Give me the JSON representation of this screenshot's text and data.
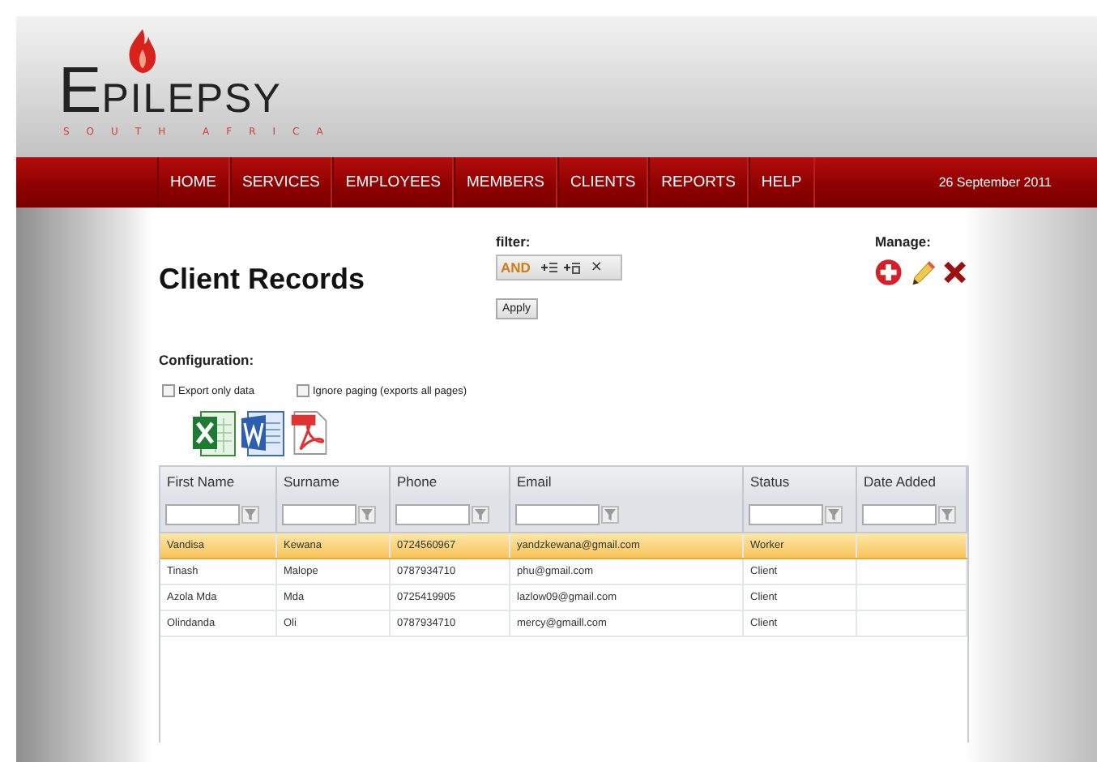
{
  "logo": {
    "initial": "E",
    "rest": "PILEPSY",
    "tagline": "SOUTH AFRICA"
  },
  "nav": {
    "items": [
      "HOME",
      "SERVICES",
      "EMPLOYEES",
      "MEMBERS",
      "CLIENTS",
      "REPORTS",
      "HELP"
    ],
    "date": "26 September 2011"
  },
  "page_title": "Client Records",
  "filter": {
    "label": "filter:",
    "operator": "AND",
    "remove": "×",
    "apply": "Apply"
  },
  "manage": {
    "label": "Manage:"
  },
  "configuration": {
    "label": "Configuration:",
    "options": [
      {
        "label": "Export only data",
        "checked": false
      },
      {
        "label": "Ignore paging (exports all pages)",
        "checked": false
      }
    ]
  },
  "table": {
    "columns": [
      "First Name",
      "Surname",
      "Phone",
      "Email",
      "Status",
      "Date Added"
    ],
    "rows": [
      {
        "selected": true,
        "cells": [
          "Vandisa",
          "Kewana",
          "0724560967",
          "yandzkewana@gmail.com",
          "Worker"
        ]
      },
      {
        "selected": false,
        "cells": [
          "Tinash",
          "Malope",
          "0787934710",
          "phu@gmail.com",
          "Client"
        ]
      },
      {
        "selected": false,
        "cells": [
          "Azola Mda",
          "Mda",
          "0725419905",
          "lazlow09@gmail.com",
          "Client"
        ]
      },
      {
        "selected": false,
        "cells": [
          "Olindanda",
          "Oli",
          "0787934710",
          "mercy@gmaill.com",
          "Client"
        ]
      }
    ]
  }
}
